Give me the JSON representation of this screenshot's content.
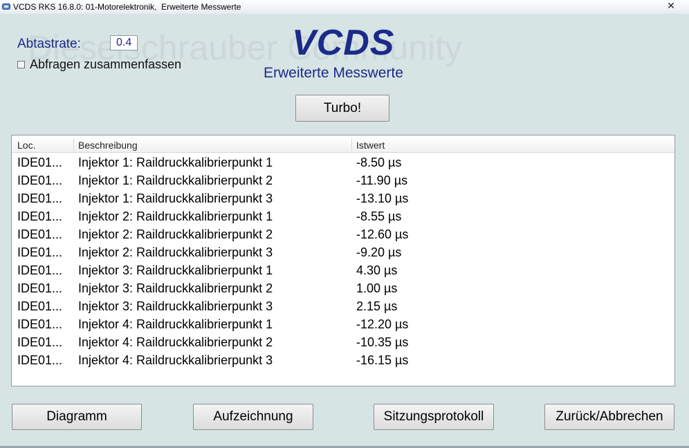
{
  "window": {
    "title": "VCDS RKS 16.8.0: 01-Motorelektronik,  Erweiterte Messwerte",
    "close_glyph": "✕"
  },
  "header": {
    "rate_label": "Abtastrate:",
    "rate_value": "0.4",
    "combine_label": "Abfragen zusammenfassen",
    "logo": "VCDS",
    "subtitle": "Erweiterte Messwerte",
    "turbo_label": "Turbo!",
    "watermark": "Dieselschrauber Community"
  },
  "table": {
    "columns": {
      "loc": "Loc.",
      "desc": "Beschreibung",
      "value": "Istwert"
    },
    "rows": [
      {
        "loc": "IDE01...",
        "desc": "Injektor 1: Raildruckkalibrierpunkt 1",
        "value": "-8.50 µs"
      },
      {
        "loc": "IDE01...",
        "desc": "Injektor 1: Raildruckkalibrierpunkt 2",
        "value": "-11.90 µs"
      },
      {
        "loc": "IDE01...",
        "desc": "Injektor 1: Raildruckkalibrierpunkt 3",
        "value": "-13.10 µs"
      },
      {
        "loc": "IDE01...",
        "desc": "Injektor 2: Raildruckkalibrierpunkt 1",
        "value": "-8.55 µs"
      },
      {
        "loc": "IDE01...",
        "desc": "Injektor 2: Raildruckkalibrierpunkt 2",
        "value": "-12.60 µs"
      },
      {
        "loc": "IDE01...",
        "desc": "Injektor 2: Raildruckkalibrierpunkt 3",
        "value": "-9.20 µs"
      },
      {
        "loc": "IDE01...",
        "desc": "Injektor 3: Raildruckkalibrierpunkt 1",
        "value": "4.30 µs"
      },
      {
        "loc": "IDE01...",
        "desc": "Injektor 3: Raildruckkalibrierpunkt 2",
        "value": "1.00 µs"
      },
      {
        "loc": "IDE01...",
        "desc": "Injektor 3: Raildruckkalibrierpunkt 3",
        "value": "2.15 µs"
      },
      {
        "loc": "IDE01...",
        "desc": "Injektor 4: Raildruckkalibrierpunkt 1",
        "value": "-12.20 µs"
      },
      {
        "loc": "IDE01...",
        "desc": "Injektor 4: Raildruckkalibrierpunkt 2",
        "value": "-10.35 µs"
      },
      {
        "loc": "IDE01...",
        "desc": "Injektor 4: Raildruckkalibrierpunkt 3",
        "value": "-16.15 µs"
      }
    ]
  },
  "footer": {
    "diagram_label": "Diagramm",
    "record_label": "Aufzeichnung",
    "session_label": "Sitzungsprotokoll",
    "back_label": "Zurück/Abbrechen"
  }
}
